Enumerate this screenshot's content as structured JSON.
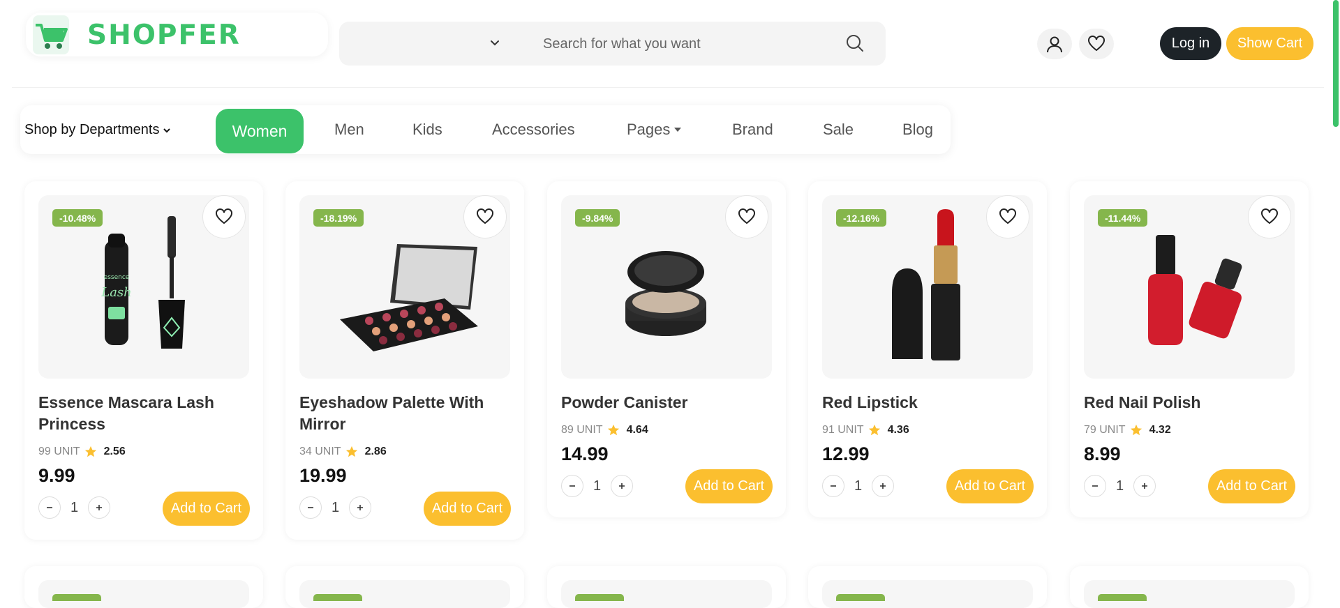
{
  "brand": {
    "name": "SHOPFER",
    "accent": "#3cc26a",
    "yellow": "#fbbf2f",
    "dark": "#1d2328"
  },
  "search": {
    "placeholder": "Search for what you want",
    "value": ""
  },
  "header": {
    "login_label": "Log in",
    "cart_label": "Show Cart"
  },
  "nav": {
    "departments_label": "Shop by Departments",
    "items": [
      "Women",
      "Men",
      "Kids",
      "Accessories",
      "Pages",
      "Brand",
      "Sale",
      "Blog"
    ],
    "active": "Women"
  },
  "products": [
    {
      "title": "Essence Mascara Lash Princess",
      "discount": "-10.48%",
      "stock": "99 UNIT",
      "rating": "2.56",
      "price": "9.99",
      "qty": "1",
      "add_label": "Add to Cart",
      "image": "mascara"
    },
    {
      "title": "Eyeshadow Palette With Mirror",
      "discount": "-18.19%",
      "stock": "34 UNIT",
      "rating": "2.86",
      "price": "19.99",
      "qty": "1",
      "add_label": "Add to Cart",
      "image": "eyeshadow-palette"
    },
    {
      "title": "Powder Canister",
      "discount": "-9.84%",
      "stock": "89 UNIT",
      "rating": "4.64",
      "price": "14.99",
      "qty": "1",
      "add_label": "Add to Cart",
      "image": "powder-compact"
    },
    {
      "title": "Red Lipstick",
      "discount": "-12.16%",
      "stock": "91 UNIT",
      "rating": "4.36",
      "price": "12.99",
      "qty": "1",
      "add_label": "Add to Cart",
      "image": "lipstick"
    },
    {
      "title": "Red Nail Polish",
      "discount": "-11.44%",
      "stock": "79 UNIT",
      "rating": "4.32",
      "price": "8.99",
      "qty": "1",
      "add_label": "Add to Cart",
      "image": "nail-polish"
    }
  ]
}
